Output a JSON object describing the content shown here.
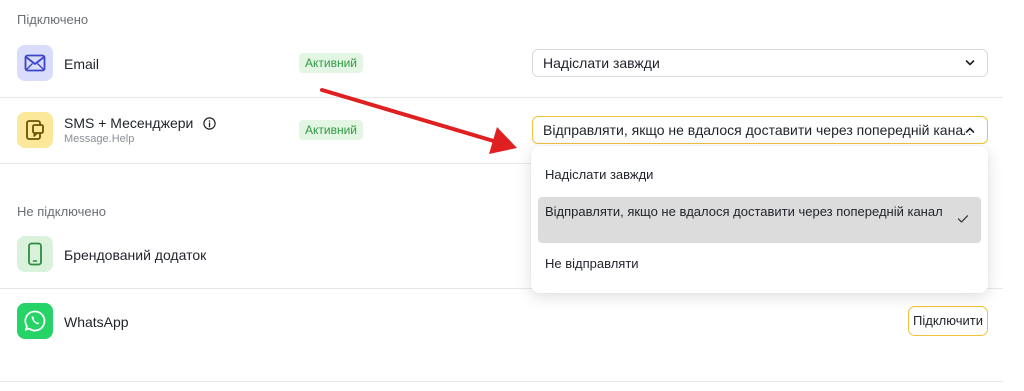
{
  "connected": {
    "title": "Підключено",
    "channels": [
      {
        "name": "Email",
        "status": "Активний",
        "select_value": "Надіслати завжди",
        "icon": "envelope-icon"
      },
      {
        "name": "SMS + Месенджери",
        "subtitle": "Message.Help",
        "status": "Активний",
        "select_value": "Відправляти, якщо не вдалося доставити через попередній канал",
        "icon": "chat-phone-icon"
      }
    ]
  },
  "dropdown": {
    "options": [
      {
        "label": "Надіслати завжди",
        "selected": false
      },
      {
        "label": "Відправляти, якщо не вдалося доставити через попередній канал",
        "selected": true
      },
      {
        "label": "Не відправляти",
        "selected": false
      }
    ]
  },
  "not_connected": {
    "title": "Не підключено",
    "channels": [
      {
        "name": "Брендований додаток",
        "icon": "smartphone-icon"
      },
      {
        "name": "WhatsApp",
        "icon": "whatsapp-icon",
        "action_label": "Підключити"
      }
    ]
  },
  "colors": {
    "accent_yellow": "#f0c23a",
    "badge_green_bg": "#e3f6e3",
    "badge_green_text": "#2f9a41",
    "arrow_red": "#e02020"
  }
}
